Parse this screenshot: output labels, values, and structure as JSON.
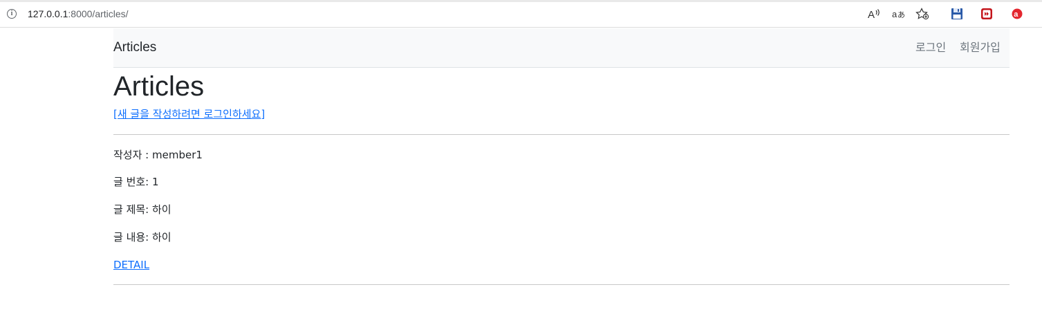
{
  "browser": {
    "url_host": "127.0.0.1",
    "url_rest": ":8000/articles/",
    "icons": [
      "info-icon",
      "read-aloud-icon",
      "translate-icon",
      "favorites-icon",
      "save-icon",
      "media-icon",
      "extension-icon"
    ]
  },
  "nav": {
    "brand": "Articles",
    "links": [
      "로그인",
      "회원가입"
    ]
  },
  "main": {
    "title": "Articles",
    "create_prompt": "[새 글을 작성하려면 로그인하세요]"
  },
  "articles": [
    {
      "author": "작성자 : member1",
      "number": "글 번호: 1",
      "title": "글 제목: 하이",
      "content": "글 내용: 하이",
      "detail_label": "DETAIL"
    }
  ],
  "colors": {
    "link": "#0d6efd",
    "nav_bg": "#f8f9fa",
    "text": "#212529",
    "nav_link": "#6c757d"
  }
}
